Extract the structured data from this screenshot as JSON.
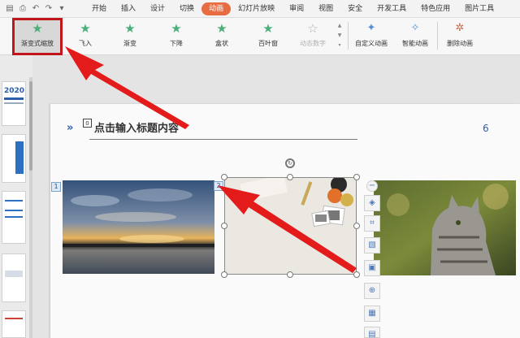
{
  "menubar": {
    "quick_icons": [
      "save-icon",
      "print-icon",
      "undo-icon",
      "redo-icon",
      "more-icon"
    ],
    "tabs": [
      "开始",
      "插入",
      "设计",
      "切换",
      "动画",
      "幻灯片放映",
      "审阅",
      "视图",
      "安全",
      "开发工具",
      "特色应用",
      "图片工具"
    ],
    "active_tab": "动画"
  },
  "ribbon": {
    "effects": [
      {
        "label": "渐变式缩放",
        "state": "selected"
      },
      {
        "label": "飞入",
        "state": "normal"
      },
      {
        "label": "渐变",
        "state": "normal"
      },
      {
        "label": "下降",
        "state": "normal"
      },
      {
        "label": "盒状",
        "state": "normal"
      },
      {
        "label": "百叶窗",
        "state": "normal"
      },
      {
        "label": "动态数字",
        "state": "disabled"
      }
    ],
    "tools": [
      "自定义动画",
      "智能动画",
      "删除动画"
    ]
  },
  "slide": {
    "title_badge": "0",
    "title": "点击输入标题内容",
    "page_number": "6",
    "photos": [
      {
        "badge": "1",
        "desc": "sunset-lake-photo"
      },
      {
        "badge": "2",
        "desc": "desk-flatlay-photo"
      },
      {
        "badge": "",
        "desc": "cat-photo"
      }
    ]
  },
  "left_panel": {
    "thumb_text": "2020"
  },
  "colors": {
    "accent": "#e86c41",
    "highlight": "#c0151b",
    "arrow": "#e31b1b",
    "title_blue": "#2d5ea8"
  }
}
